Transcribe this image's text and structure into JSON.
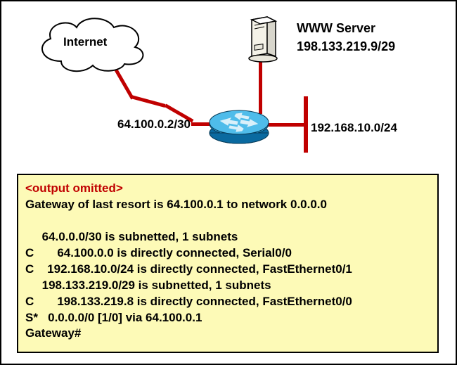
{
  "diagram": {
    "cloud_label": "Internet",
    "server_label": "WWW Server",
    "server_ip": "198.133.219.9/29",
    "wan_ip": "64.100.0.2/30",
    "lan_net": "192.168.10.0/24"
  },
  "terminal": {
    "omitted": "<output omitted>",
    "gateway_line": "Gateway of last resort is 64.100.0.1 to network 0.0.0.0",
    "route1a": "     64.0.0.0/30 is subnetted, 1 subnets",
    "route1b": "C       64.100.0.0 is directly connected, Serial0/0",
    "route2": "C    192.168.10.0/24 is directly connected, FastEthernet0/1",
    "route3a": "     198.133.219.0/29 is subnetted, 1 subnets",
    "route3b": "C       198.133.219.8 is directly connected, FastEthernet0/0",
    "default": "S*   0.0.0.0/0 [1/0] via 64.100.0.1",
    "prompt": "Gateway#"
  }
}
